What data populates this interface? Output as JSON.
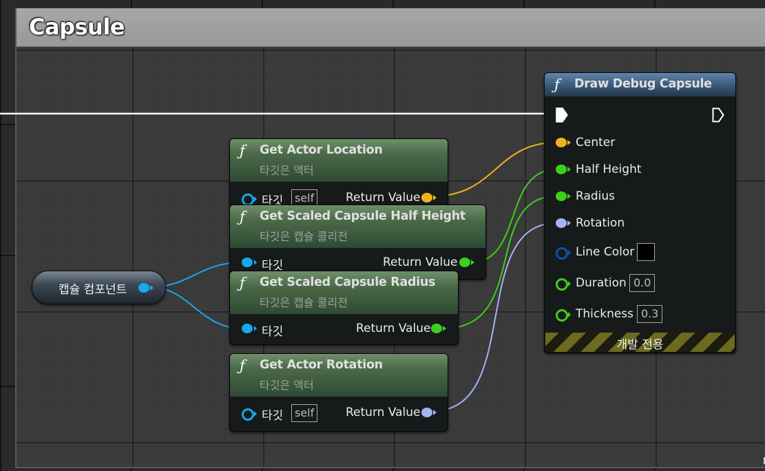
{
  "comment": {
    "title": "Capsule"
  },
  "variable_node": {
    "label": "캡슐 컴포넌트"
  },
  "nodes": {
    "get_actor_location": {
      "title": "Get Actor Location",
      "subtitle": "타깃은 액터",
      "target_label": "타깃",
      "target_default": "self",
      "return_label": "Return Value"
    },
    "get_half_height": {
      "title": "Get Scaled Capsule Half Height",
      "subtitle": "타깃은 캡슐 콜리전",
      "target_label": "타깃",
      "return_label": "Return Value"
    },
    "get_radius": {
      "title": "Get Scaled Capsule Radius",
      "subtitle": "타깃은 캡슐 콜리전",
      "target_label": "타깃",
      "return_label": "Return Value"
    },
    "get_actor_rotation": {
      "title": "Get Actor Rotation",
      "subtitle": "타깃은 액터",
      "target_label": "타깃",
      "target_default": "self",
      "return_label": "Return Value"
    },
    "draw_debug_capsule": {
      "title": "Draw Debug Capsule",
      "pins": {
        "center": "Center",
        "half_height": "Half Height",
        "radius": "Radius",
        "rotation": "Rotation",
        "line_color": "Line Color",
        "duration": "Duration",
        "duration_value": "0.0",
        "thickness": "Thickness",
        "thickness_value": "0.3"
      },
      "footer": "개발 전용"
    }
  },
  "icons": {
    "function": "ƒ"
  },
  "colors": {
    "object_pin": "#1aa7ec",
    "vector_pin": "#f0b31e",
    "float_pin": "#3ccf1e",
    "rotator_pin": "#a3b3f5",
    "color_pin": "#0f4fb5"
  }
}
